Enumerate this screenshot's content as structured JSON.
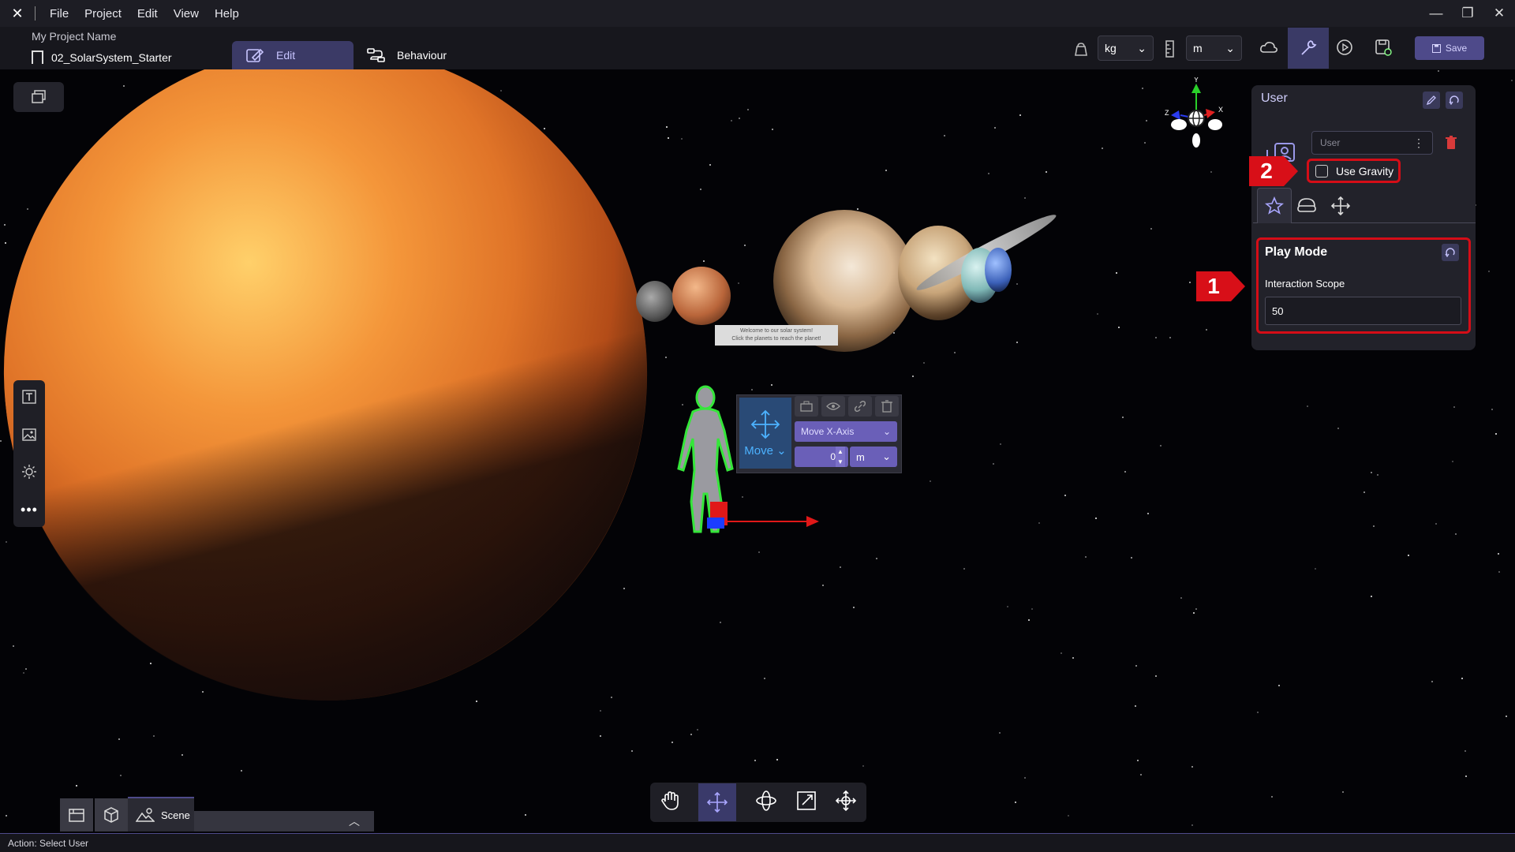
{
  "menubar": {
    "items": [
      "File",
      "Project",
      "Edit",
      "View",
      "Help"
    ]
  },
  "project": {
    "name": "My Project Name",
    "scene": "02_SolarSystem_Starter"
  },
  "modes": {
    "edit_label": "Edit",
    "behaviour_label": "Behaviour"
  },
  "units": {
    "mass": "kg",
    "length": "m"
  },
  "toolbar": {
    "save_label": "Save"
  },
  "viewport": {
    "sign_line1": "Welcome to our solar system!",
    "sign_line2": "Click the planets to reach the planet!",
    "axis_y": "Y",
    "axis_x": "X",
    "axis_z": "Z"
  },
  "gizmo": {
    "mode_label": "Move",
    "axis_select": "Move X-Axis",
    "value": "0",
    "unit": "m"
  },
  "properties": {
    "title": "User",
    "object_placeholder": "User",
    "use_gravity_label": "Use Gravity",
    "use_gravity_checked": false,
    "section_title": "Play Mode",
    "interaction_scope_label": "Interaction Scope",
    "interaction_scope_value": "50"
  },
  "callouts": {
    "one": "1",
    "two": "2"
  },
  "bottom": {
    "scene_tab_label": "Scene"
  },
  "status": {
    "text": "Action: Select User"
  },
  "colors": {
    "accent": "#4e4a8a",
    "callout_red": "#d80f18",
    "selection_green": "#35e63a"
  }
}
